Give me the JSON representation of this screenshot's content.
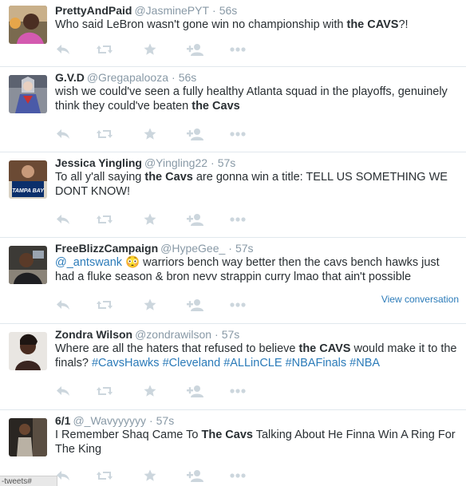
{
  "tweets": [
    {
      "fullname": "PrettyAndPaid",
      "username": "@JasminePYT",
      "sep": "·",
      "time": "56s",
      "parts": [
        {
          "t": "Who said LeBron wasn't gone win no championship with "
        },
        {
          "t": "the CAVS",
          "b": true
        },
        {
          "t": "?!"
        }
      ]
    },
    {
      "fullname": "G.V.D",
      "username": "@Gregapalooza",
      "sep": "·",
      "time": "56s",
      "parts": [
        {
          "t": "wish we could've seen a fully healthy Atlanta squad in the playoffs, genuinely think they could've beaten "
        },
        {
          "t": "the Cavs",
          "b": true
        }
      ]
    },
    {
      "fullname": "Jessica Yingling",
      "username": "@Yingling22",
      "sep": "·",
      "time": "57s",
      "avatar_text": "TAMPA BAY",
      "parts": [
        {
          "t": "To all y'all saying "
        },
        {
          "t": "the Cavs",
          "b": true
        },
        {
          "t": " are gonna win a title: TELL US SOMETHING WE DONT KNOW!"
        }
      ]
    },
    {
      "fullname": "FreeBlizzCampaign",
      "username": "@HypeGee_",
      "sep": "·",
      "time": "57s",
      "parts": [
        {
          "t": "@_antswank",
          "h": true
        },
        {
          "t": " 😳 warriors bench way better then the cavs bench hawks just had a fluke season & bron nevv strappin curry lmao that ain't possible"
        }
      ],
      "view_conversation": "View conversation"
    },
    {
      "fullname": "Zondra Wilson",
      "username": "@zondrawilson",
      "sep": "·",
      "time": "57s",
      "parts": [
        {
          "t": "Where are all the haters that refused to believe "
        },
        {
          "t": "the CAVS",
          "b": true
        },
        {
          "t": " would make it to the finals? "
        },
        {
          "t": "#CavsHawks",
          "h": true
        },
        {
          "t": " "
        },
        {
          "t": "#Cleveland",
          "h": true
        },
        {
          "t": " "
        },
        {
          "t": "#ALLinCLE",
          "h": true
        },
        {
          "t": " "
        },
        {
          "t": "#NBAFinals",
          "h": true
        },
        {
          "t": " "
        },
        {
          "t": "#NBA",
          "h": true
        }
      ]
    },
    {
      "fullname": "6/1",
      "username": "@_Wavyyyyyy",
      "sep": "·",
      "time": "57s",
      "parts": [
        {
          "t": "I Remember Shaq Came To "
        },
        {
          "t": "The Cavs",
          "b": true
        },
        {
          "t": " Talking About He Finna Win A Ring For The King"
        }
      ]
    }
  ],
  "actions": [
    "reply-icon",
    "retweet-icon",
    "favorite-icon",
    "follow-icon",
    "more-icon"
  ],
  "icon_color": "#ccd6dd",
  "link_color": "#2b7bb9",
  "stray_text": "-tweets#"
}
